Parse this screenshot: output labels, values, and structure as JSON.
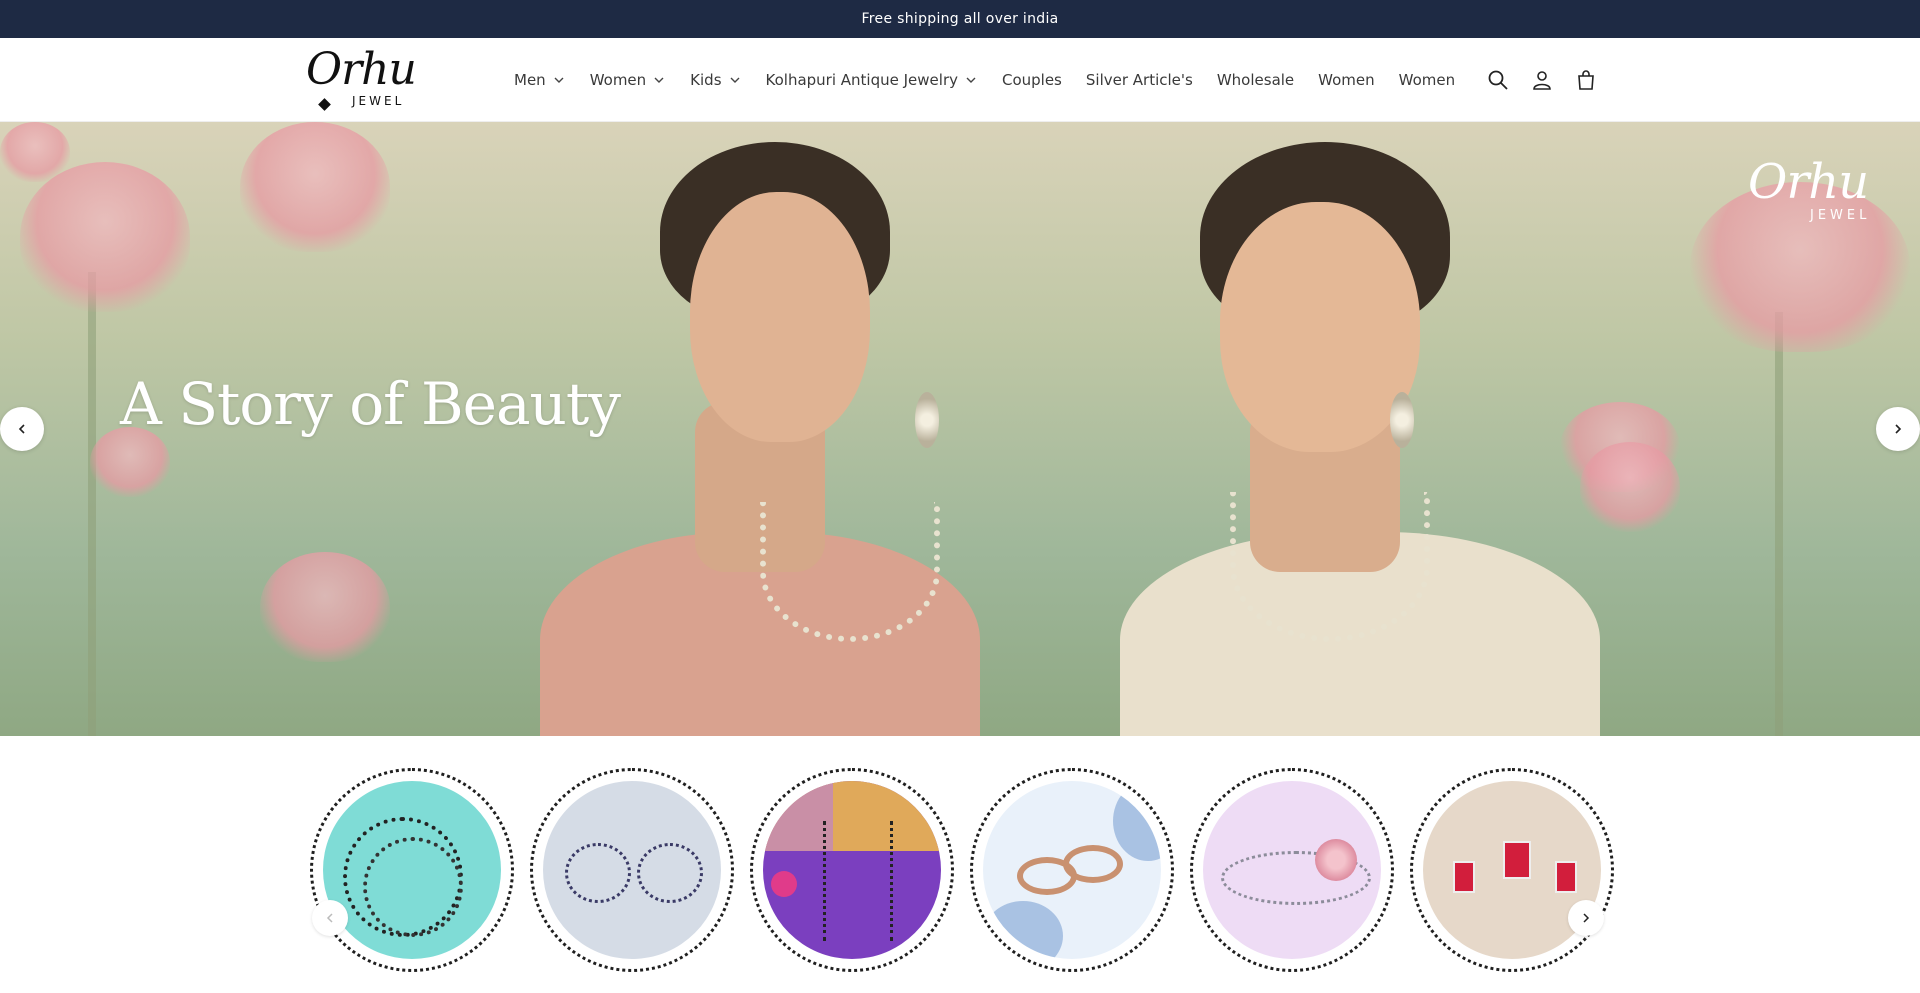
{
  "announcement": {
    "text": "Free shipping all over india"
  },
  "brand": {
    "script": "Orhu",
    "sub": "JEWEL"
  },
  "nav": {
    "items": [
      {
        "label": "Men",
        "has_dropdown": true
      },
      {
        "label": "Women",
        "has_dropdown": true
      },
      {
        "label": "Kids",
        "has_dropdown": true
      },
      {
        "label": "Kolhapuri Antique Jewelry",
        "has_dropdown": true
      },
      {
        "label": "Couples",
        "has_dropdown": false
      },
      {
        "label": "Silver Article's",
        "has_dropdown": false
      },
      {
        "label": "Wholesale",
        "has_dropdown": false
      },
      {
        "label": "Women",
        "has_dropdown": false
      },
      {
        "label": "Women",
        "has_dropdown": false
      }
    ]
  },
  "header_icons": [
    "search-icon",
    "account-icon",
    "cart-icon"
  ],
  "hero": {
    "title": "A Story of Beauty",
    "logo_script": "Orhu",
    "logo_sub": "JEWEL"
  },
  "categories": [
    {
      "icon": "anklet-black-beads-image"
    },
    {
      "icon": "anklets-pair-image"
    },
    {
      "icon": "mangalsutra-image"
    },
    {
      "icon": "couple-rings-image"
    },
    {
      "icon": "bracelet-image"
    },
    {
      "icon": "pendant-earring-set-image"
    }
  ],
  "colors": {
    "announcement_bg": "#1e2a44",
    "text": "#2b2b2b",
    "white": "#ffffff"
  }
}
